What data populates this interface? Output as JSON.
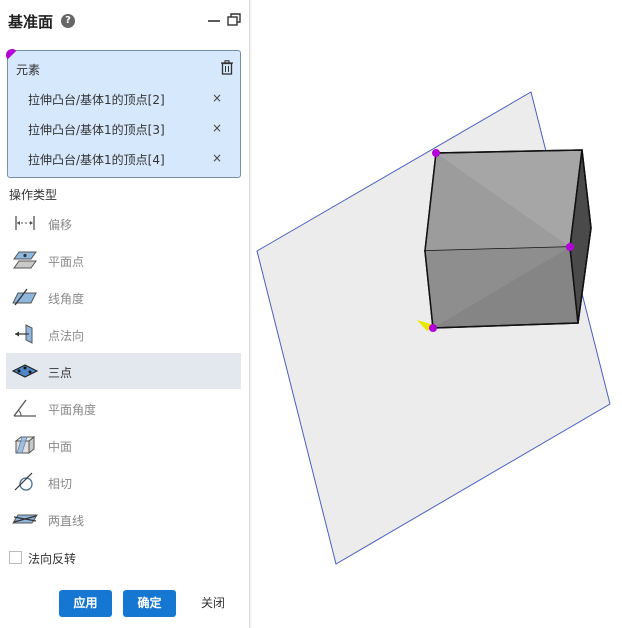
{
  "panel": {
    "title": "基准面",
    "help_icon": "question-icon",
    "elements_label": "元素",
    "elements": [
      {
        "label": "拉伸凸台/基体1的顶点[2]",
        "remove": "×"
      },
      {
        "label": "拉伸凸台/基体1的顶点[3]",
        "remove": "×"
      },
      {
        "label": "拉伸凸台/基体1的顶点[4]",
        "remove": "×"
      }
    ],
    "operation_label": "操作类型",
    "operations": [
      {
        "label": "偏移",
        "icon": "offset-icon"
      },
      {
        "label": "平面点",
        "icon": "plane-point-icon"
      },
      {
        "label": "线角度",
        "icon": "line-angle-icon"
      },
      {
        "label": "点法向",
        "icon": "point-normal-icon"
      },
      {
        "label": "三点",
        "icon": "three-point-icon",
        "selected": true
      },
      {
        "label": "平面角度",
        "icon": "plane-angle-icon"
      },
      {
        "label": "中面",
        "icon": "mid-plane-icon"
      },
      {
        "label": "相切",
        "icon": "tangent-icon"
      },
      {
        "label": "两直线",
        "icon": "two-lines-icon"
      }
    ],
    "flip_normal_label": "法向反转",
    "flip_normal_checked": false,
    "apply_label": "应用",
    "ok_label": "确定",
    "close_label": "关闭"
  },
  "colors": {
    "accent": "#1677d2",
    "selection_bg": "#d6e8fb",
    "vertex": "#b400d8",
    "plane_edge": "#4a5fc1"
  }
}
